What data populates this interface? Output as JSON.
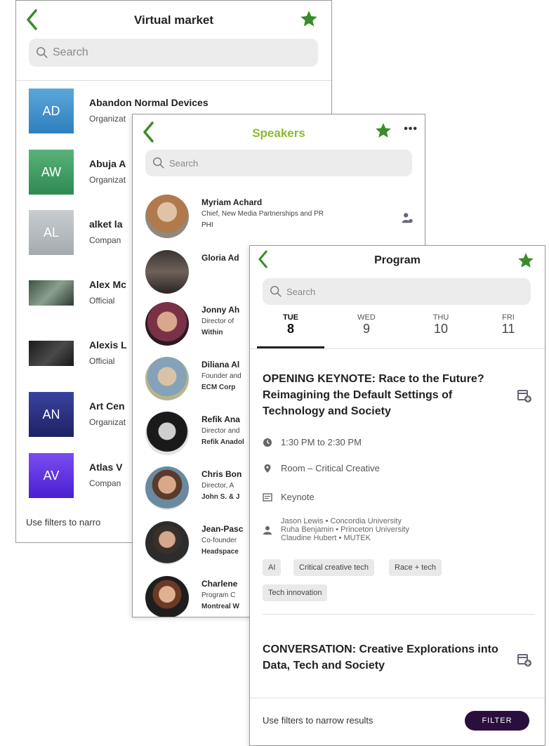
{
  "colors": {
    "accent_green": "#3a8c2a",
    "speakers_title": "#8bbb2c",
    "filter_btn": "#2a0f3e"
  },
  "market": {
    "title": "Virtual market",
    "search_placeholder": "Search",
    "items": [
      {
        "initials": "AD",
        "name": "Abandon Normal Devices",
        "type": "Organizat",
        "color": "#3f93c9"
      },
      {
        "initials": "AW",
        "name": "Abuja A",
        "type": "Organizat",
        "color": "#3f9a62"
      },
      {
        "initials": "AL",
        "name": "alket la",
        "type": "Compan",
        "color": "#b5bcc1"
      },
      {
        "initials": "",
        "name": "Alex Mc",
        "type": "Official",
        "color": "#5a7062"
      },
      {
        "initials": "",
        "name": "Alexis L",
        "type": "Official",
        "color": "#2b2b2b"
      },
      {
        "initials": "AN",
        "name": "Art Cen",
        "type": "Organizat",
        "color": "#2a2f7c"
      },
      {
        "initials": "AV",
        "name": "Atlas V",
        "type": "Compan",
        "color": "#5d2ce0"
      }
    ],
    "hint": "Use filters to narro"
  },
  "speakers": {
    "title": "Speakers",
    "more_label": "•••",
    "search_placeholder": "Search",
    "items": [
      {
        "name": "Myriam Achard",
        "role": "Chief, New Media Partnerships and PR",
        "org": "PHI",
        "color": "#b88a62"
      },
      {
        "name": "Gloria Ad",
        "role": "",
        "org": "",
        "color": "#4a403c"
      },
      {
        "name": "Jonny Ah",
        "role": "Director of",
        "org": "Within",
        "color": "#6b3a4e"
      },
      {
        "name": "Diliana Al",
        "role": "Founder and",
        "org": "ECM Corp",
        "color": "#8aa4ba"
      },
      {
        "name": "Refik Ana",
        "role": "Director and",
        "org": "Refik Anadol",
        "color": "#3a3a3a"
      },
      {
        "name": "Chris Bon",
        "role": "Director, A",
        "org": "John S. & J",
        "color": "#a5856c"
      },
      {
        "name": "Jean-Pasc",
        "role": "Co-founder",
        "org": "Headspace",
        "color": "#7c6c62"
      },
      {
        "name": "Charlene",
        "role": "Program C",
        "org": "Montreal W",
        "color": "#c08a6a"
      }
    ]
  },
  "program": {
    "title": "Program",
    "search_placeholder": "Search",
    "days": [
      {
        "name": "TUE",
        "num": "8"
      },
      {
        "name": "WED",
        "num": "9"
      },
      {
        "name": "THU",
        "num": "10"
      },
      {
        "name": "FRI",
        "num": "11"
      }
    ],
    "events": [
      {
        "title": "OPENING KEYNOTE: Race to the Future? Reimagining the Default Settings of Technology and Society",
        "time": "1:30 PM to 2:30 PM",
        "room": "Room – Critical Creative",
        "kind": "Keynote",
        "speakers": [
          "Jason Lewis • Concordia University",
          "Ruha Benjamin • Princeton University",
          "Claudine Hubert • MUTEK"
        ],
        "tags": [
          "AI",
          "Critical creative tech",
          "Race + tech",
          "Tech innovation"
        ]
      },
      {
        "title": "CONVERSATION: Creative Explorations into Data, Tech and Society"
      }
    ],
    "hint": "Use filters to narrow results",
    "filter_label": "FILTER"
  }
}
